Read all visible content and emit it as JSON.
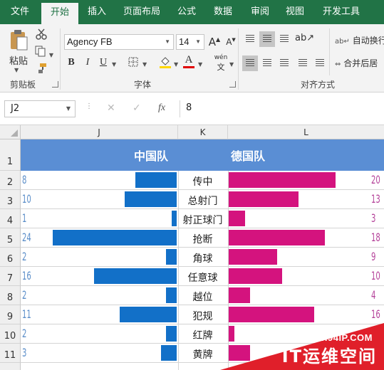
{
  "tabs": [
    "文件",
    "开始",
    "插入",
    "页面布局",
    "公式",
    "数据",
    "审阅",
    "视图",
    "开发工具"
  ],
  "ribbon": {
    "clipboard": {
      "paste_label": "粘贴",
      "group_label": "剪贴板"
    },
    "font": {
      "family": "Agency FB",
      "size": "14",
      "group_label": "字体",
      "bold": "B",
      "italic": "I",
      "underline": "U",
      "font_color_glyph": "A",
      "phonetic_glyph": "wén"
    },
    "alignment": {
      "group_label": "对齐方式",
      "wrap_label": "自动换行",
      "merge_label": "合并后居"
    }
  },
  "formula_bar": {
    "name_box": "J2",
    "cancel": "✕",
    "enter": "✓",
    "fx": "fx",
    "content": "8"
  },
  "grid": {
    "columns": [
      "J",
      "K",
      "L"
    ],
    "rows": [
      "1",
      "2",
      "3",
      "4",
      "5",
      "6",
      "7",
      "8",
      "9",
      "10",
      "11"
    ],
    "team_left": "中国队",
    "team_right": "德国队"
  },
  "chart_data": {
    "type": "bar",
    "title": "",
    "categories": [
      "传中",
      "总射门",
      "射正球门",
      "抢断",
      "角球",
      "任意球",
      "越位",
      "犯规",
      "红牌",
      "黄牌"
    ],
    "series": [
      {
        "name": "中国队",
        "values": [
          8,
          10,
          1,
          24,
          2,
          16,
          2,
          11,
          2,
          3
        ],
        "color": "#1270c8"
      },
      {
        "name": "德国队",
        "values": [
          20,
          13,
          3,
          18,
          9,
          10,
          4,
          16,
          1,
          4
        ],
        "color": "#d4137e"
      }
    ],
    "value_label_color_left": "#5b8ec9",
    "value_label_color_right": "#b5439a"
  },
  "watermark": {
    "url": "WWW.94IP.COM",
    "name": "IT运维空间"
  }
}
